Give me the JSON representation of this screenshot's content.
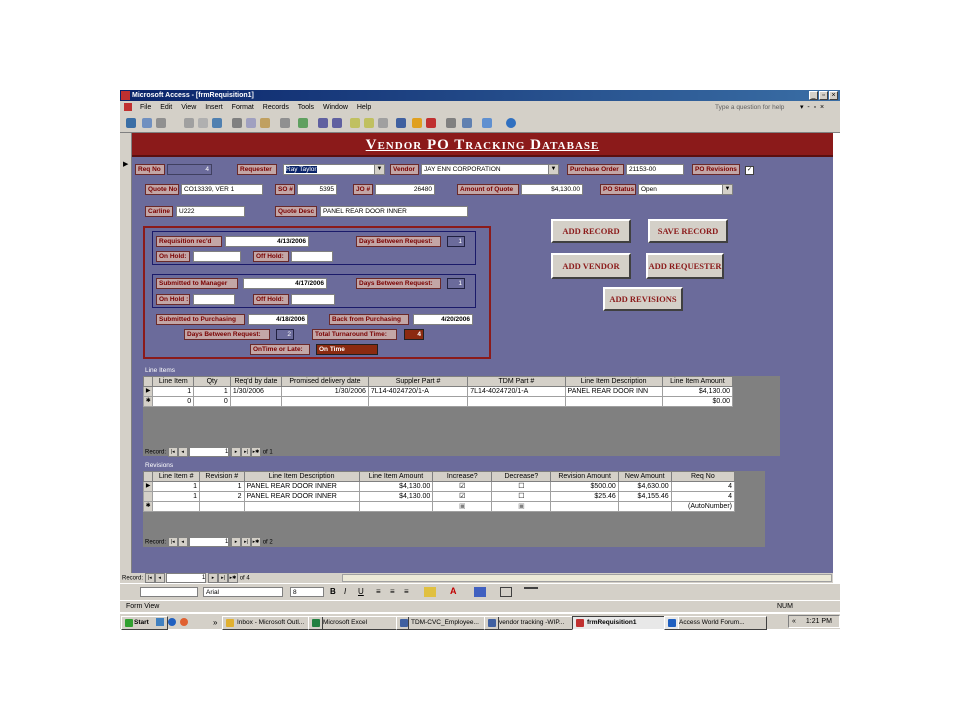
{
  "window": {
    "title": "Microsoft Access - [frmRequisition1]",
    "menu": [
      "File",
      "Edit",
      "View",
      "Insert",
      "Format",
      "Records",
      "Tools",
      "Window",
      "Help"
    ],
    "help_placeholder": "Type a question for help"
  },
  "form": {
    "banner": "Vendor PO Tracking Database",
    "req_no": {
      "label": "Req No",
      "value": "4"
    },
    "requester": {
      "label": "Requester",
      "value": "Ray Taylor"
    },
    "vendor": {
      "label": "Vendor",
      "value": "JAY ENN CORPORATION"
    },
    "purchase_order": {
      "label": "Purchase Order",
      "value": "21153-00"
    },
    "po_revisions": {
      "label": "PO Revisions",
      "checked": true
    },
    "quote_no": {
      "label": "Quote No",
      "value": "CO13339, VER 1"
    },
    "so_no": {
      "label": "SO #",
      "value": "5395"
    },
    "jo_no": {
      "label": "JO #",
      "value": "26480"
    },
    "amount_of_quote": {
      "label": "Amount of Quote",
      "value": "$4,130.00"
    },
    "po_status": {
      "label": "PO Status",
      "value": "Open"
    },
    "carline": {
      "label": "Carline",
      "value": "U222"
    },
    "quote_desc": {
      "label": "Quote Desc",
      "value": "PANEL REAR DOOR INNER"
    },
    "requisition_recd": {
      "label": "Requisition rec'd",
      "value": "4/13/2006"
    },
    "days_between_1": {
      "label": "Days Between Request:",
      "value": "1"
    },
    "on_hold_1": {
      "label": "On Hold:",
      "value": ""
    },
    "off_hold_1": {
      "label": "Off Hold:",
      "value": ""
    },
    "submitted_to_manager": {
      "label": "Submitted to Manager",
      "value": "4/17/2006"
    },
    "days_between_2": {
      "label": "Days Between Request:",
      "value": "1"
    },
    "on_hold_2": {
      "label": "On Hold :",
      "value": ""
    },
    "off_hold_2": {
      "label": "Off Hold:",
      "value": ""
    },
    "submitted_to_purchasing": {
      "label": "Submitted to Purchasing",
      "value": "4/18/2006"
    },
    "back_from_purchasing": {
      "label": "Back from Purchasing",
      "value": "4/20/2006"
    },
    "days_between_3": {
      "label": "Days Between Request:",
      "value": "2"
    },
    "total_turnaround": {
      "label": "Total Turnaround Time:",
      "value": "4"
    },
    "ontime_or_late": {
      "label": "OnTime or Late:",
      "value": "On Time"
    },
    "buttons": {
      "add_record": "ADD RECORD",
      "save_record": "SAVE RECORD",
      "add_vendor": "ADD VENDOR",
      "add_requester": "ADD REQUESTER",
      "add_revisions": "ADD REVISIONS"
    }
  },
  "line_items": {
    "caption": "Line Items",
    "columns": [
      "Line Item",
      "Qty",
      "Req'd by date",
      "Promised delivery date",
      "Suppler Part #",
      "TDM Part #",
      "Line Item Description",
      "Line Item Amount"
    ],
    "rows": [
      [
        "1",
        "1",
        "1/30/2006",
        "1/30/2006",
        "7L14-4024720/1-A",
        "7L14-4024720/1-A",
        "PANEL REAR DOOR INN",
        "$4,130.00"
      ],
      [
        "0",
        "0",
        "",
        "",
        "",
        "",
        "",
        "$0.00"
      ]
    ],
    "nav": {
      "label": "Record:",
      "current": "1",
      "of": "of 1"
    }
  },
  "revisions": {
    "caption": "Revisions",
    "columns": [
      "Line Item #",
      "Revision #",
      "Line Item Description",
      "Line Item Amount",
      "Increase?",
      "Decrease?",
      "Revision Amount",
      "New Amount",
      "Req No"
    ],
    "rows": [
      [
        "1",
        "1",
        "PANEL REAR DOOR INNER",
        "$4,130.00",
        "☑",
        "☐",
        "$500.00",
        "$4,630.00",
        "4"
      ],
      [
        "1",
        "2",
        "PANEL REAR DOOR INNER",
        "$4,130.00",
        "☑",
        "☐",
        "$25.46",
        "$4,155.46",
        "4"
      ],
      [
        "",
        "",
        "",
        "",
        "▣",
        "▣",
        "",
        "",
        "(AutoNumber)"
      ]
    ],
    "nav": {
      "label": "Record:",
      "current": "1",
      "of": "of 2"
    }
  },
  "main_nav": {
    "label": "Record:",
    "current": "1",
    "of": "of 4"
  },
  "format_bar": {
    "font": "Arial",
    "size": "8"
  },
  "status": {
    "left": "Form View",
    "right": "NUM"
  },
  "taskbar": {
    "start": "Start",
    "tasks": [
      "Inbox - Microsoft Outl...",
      "Microsoft Excel",
      "TDM-CVC_Employee...",
      "vendor tracking -WIP...",
      "frmRequisition1",
      "Access World Forum..."
    ],
    "clock": "1:21 PM"
  }
}
